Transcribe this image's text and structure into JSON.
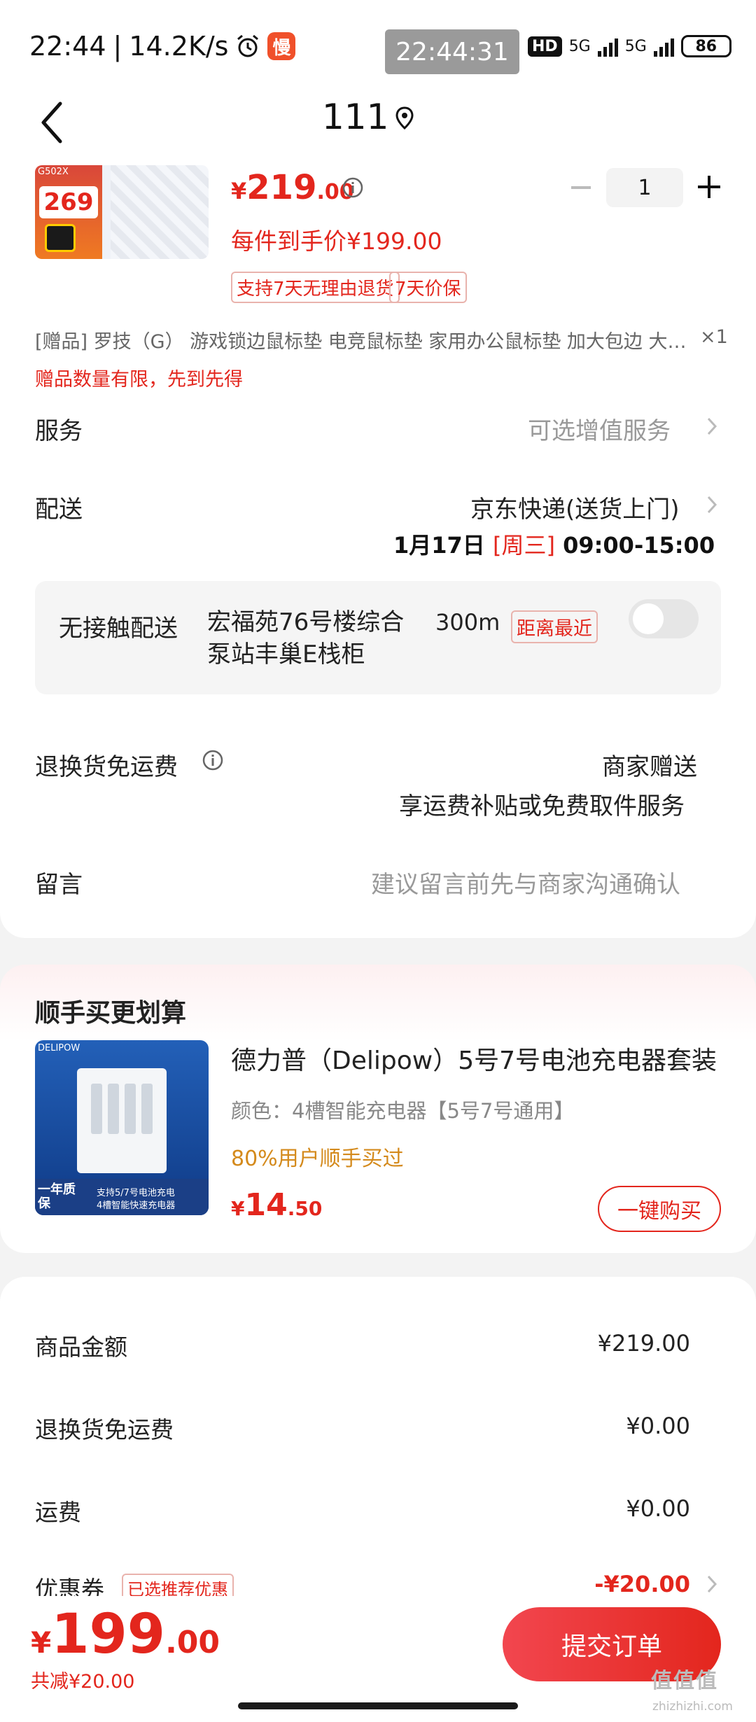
{
  "status_bar": {
    "time": "22:44",
    "speed": "14.2K/s",
    "alarm_icon": "alarm-icon",
    "app_badge": "慢",
    "clock_overlay": "22:44:31",
    "hd": "HD",
    "net1": "5G",
    "net2": "5G",
    "battery": "86"
  },
  "header": {
    "title": "111",
    "back_icon": "chevron-left-icon",
    "location_icon": "location-pin-icon"
  },
  "product": {
    "image_price": "269",
    "image_tag": "G502X",
    "price_currency": "¥",
    "price_int": "219",
    "price_dec": ".00",
    "final_price": "每件到手价¥199.00",
    "quantity": "1",
    "badges": [
      "支持7天无理由退货",
      "7天价保"
    ]
  },
  "gift": {
    "text": "[赠品] 罗技（G） 游戏锁边鼠标垫 电竞鼠标垫 家用办公鼠标垫 加大包边 大号鼠标垫",
    "qty": "×1",
    "note": "赠品数量有限，先到先得"
  },
  "service": {
    "label": "服务",
    "value": "可选增值服务"
  },
  "delivery": {
    "label": "配送",
    "value": "京东快递(送货上门)",
    "date": "1月17日",
    "weekday": "[周三]",
    "time": "09:00-15:00"
  },
  "contactless": {
    "label": "无接触配送",
    "place": "宏福苑76号楼综合泵站丰巢E栈柜",
    "distance": "300m",
    "tag": "距离最近",
    "enabled": false
  },
  "return_shipping": {
    "label": "退换货免运费",
    "value": "商家赠送",
    "sub": "享运费补贴或免费取件服务"
  },
  "message": {
    "label": "留言",
    "placeholder": "建议留言前先与商家沟通确认"
  },
  "upsell": {
    "title": "顺手买更划算",
    "name": "德力普（Delipow）5号7号电池充电器套装",
    "spec": "颜色：4槽智能充电器【5号7号通用】",
    "social": "80%用户顺手买过",
    "price_currency": "¥",
    "price_int": "14",
    "price_dec": ".50",
    "button": "一键购买",
    "img_brand": "DELIPOW",
    "img_warranty": "一年质保",
    "img_text1": "支持5/7号电池充电",
    "img_text2": "4槽智能快速充电器"
  },
  "summary": {
    "items": [
      {
        "label": "商品金额",
        "value": "¥219.00"
      },
      {
        "label": "退换货免运费",
        "value": "¥0.00"
      },
      {
        "label": "运费",
        "value": "¥0.00"
      }
    ],
    "coupon_label": "优惠券",
    "coupon_chip": "已选推荐优惠",
    "coupon_value": "-¥20.00"
  },
  "bottom": {
    "currency": "¥",
    "total_int": "199",
    "total_dec": ".00",
    "saved": "共减¥20.00",
    "submit": "提交订单"
  },
  "watermark": {
    "main": "值值值",
    "sub": "zhizhizhi.com"
  },
  "colors": {
    "accent": "#e3261d",
    "orange": "#d48a1c",
    "bg": "#f3f3f3"
  }
}
